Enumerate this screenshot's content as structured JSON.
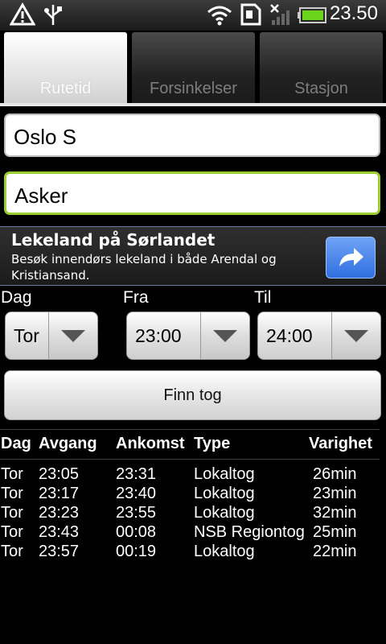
{
  "status": {
    "time": "23.50",
    "icons": [
      "warning-icon",
      "usb-icon",
      "wifi-icon",
      "sim-icon",
      "no-signal-icon",
      "battery-icon"
    ]
  },
  "tabs": [
    {
      "label": "Rutetid",
      "active": true
    },
    {
      "label": "Forsinkelser",
      "active": false
    },
    {
      "label": "Stasjon",
      "active": false
    }
  ],
  "from_field": {
    "value": "Oslo S"
  },
  "to_field": {
    "value": "Asker"
  },
  "ad": {
    "title": "Lekeland på Sørlandet",
    "text": "Besøk innendørs lekeland i både Arendal og Kristiansand."
  },
  "selectors": {
    "day_label": "Dag",
    "day_value": "Tor",
    "from_label": "Fra",
    "from_value": "23:00",
    "to_label": "Til",
    "to_value": "24:00"
  },
  "find_button": "Finn tog",
  "table": {
    "headers": [
      "Dag",
      "Avgang",
      "Ankomst",
      "Type",
      "Varighet"
    ],
    "rows": [
      [
        "Tor",
        "23:05",
        "23:31",
        "Lokaltog",
        "26min"
      ],
      [
        "Tor",
        "23:17",
        "23:40",
        "Lokaltog",
        "23min"
      ],
      [
        "Tor",
        "23:23",
        "23:55",
        "Lokaltog",
        "32min"
      ],
      [
        "Tor",
        "23:43",
        "00:08",
        "NSB Regiontog",
        "25min"
      ],
      [
        "Tor",
        "23:57",
        "00:19",
        "Lokaltog",
        "22min"
      ]
    ]
  },
  "colors": {
    "focus_border": "#9acd32",
    "ad_button": "#3b7bea"
  }
}
